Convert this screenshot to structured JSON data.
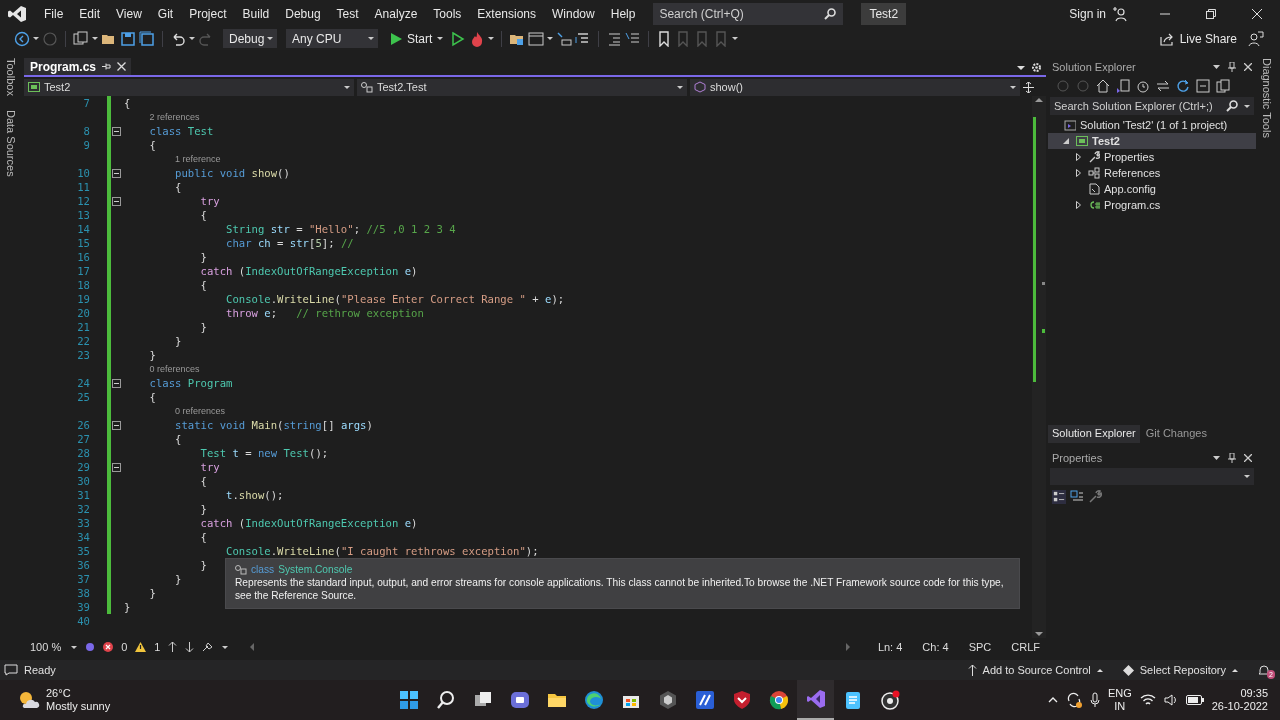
{
  "menu_bar": {
    "items": [
      "File",
      "Edit",
      "View",
      "Git",
      "Project",
      "Build",
      "Debug",
      "Test",
      "Analyze",
      "Tools",
      "Extensions",
      "Window",
      "Help"
    ],
    "search": {
      "placeholder": "Search (Ctrl+Q)"
    },
    "solution_name": "Test2",
    "sign_in": "Sign in"
  },
  "toolbar": {
    "configuration": "Debug",
    "platform": "Any CPU",
    "start": "Start",
    "live_share": "Live Share"
  },
  "left_strip": [
    "Toolbox",
    "Data Sources"
  ],
  "right_strip": [
    "Diagnostic Tools"
  ],
  "editor": {
    "tabs": [
      {
        "label": "Program.cs",
        "selected": true
      }
    ],
    "nav": [
      "Test2",
      "Test2.Test",
      "show()"
    ],
    "lines": [
      {
        "kind": "code",
        "num": "7",
        "changed": true,
        "tokens": [
          {
            "kind": "txt",
            "text": "{"
          }
        ]
      },
      {
        "kind": "lens",
        "changed": true,
        "text": "2 references"
      },
      {
        "kind": "code",
        "num": "8",
        "changed": true,
        "fold": true,
        "tokens": [
          {
            "kind": "kw",
            "text": "    class "
          },
          {
            "kind": "type",
            "text": "Test"
          }
        ]
      },
      {
        "kind": "code",
        "num": "9",
        "changed": true,
        "tokens": [
          {
            "kind": "txt",
            "text": "    {"
          }
        ]
      },
      {
        "kind": "lens",
        "changed": true,
        "text": "1 reference"
      },
      {
        "kind": "code",
        "num": "10",
        "changed": true,
        "fold": true,
        "tokens": [
          {
            "kind": "kw",
            "text": "        public void "
          },
          {
            "kind": "fn",
            "text": "show"
          },
          {
            "kind": "txt",
            "text": "()"
          }
        ]
      },
      {
        "kind": "code",
        "num": "11",
        "changed": true,
        "tokens": [
          {
            "kind": "txt",
            "text": "        {"
          }
        ]
      },
      {
        "kind": "code",
        "num": "12",
        "changed": true,
        "fold": true,
        "tokens": [
          {
            "kind": "ctl",
            "text": "            try"
          }
        ]
      },
      {
        "kind": "code",
        "num": "13",
        "changed": true,
        "tokens": [
          {
            "kind": "txt",
            "text": "            {"
          }
        ]
      },
      {
        "kind": "code",
        "num": "14",
        "changed": true,
        "tokens": [
          {
            "kind": "type",
            "text": "                String"
          },
          {
            "kind": "var",
            "text": " str"
          },
          {
            "kind": "txt",
            "text": " = "
          },
          {
            "kind": "str",
            "text": "\"Hello\""
          },
          {
            "kind": "txt",
            "text": "; "
          },
          {
            "kind": "cmt",
            "text": "//5 ,0 1 2 3 4"
          }
        ]
      },
      {
        "kind": "code",
        "num": "15",
        "changed": true,
        "tokens": [
          {
            "kind": "kw",
            "text": "                char"
          },
          {
            "kind": "var",
            "text": " ch"
          },
          {
            "kind": "txt",
            "text": " = "
          },
          {
            "kind": "var",
            "text": "str"
          },
          {
            "kind": "txt",
            "text": "["
          },
          {
            "kind": "num",
            "text": "5"
          },
          {
            "kind": "txt",
            "text": "]; "
          },
          {
            "kind": "cmt",
            "text": "//"
          }
        ]
      },
      {
        "kind": "code",
        "num": "16",
        "changed": true,
        "tokens": [
          {
            "kind": "txt",
            "text": "            }"
          }
        ]
      },
      {
        "kind": "code",
        "num": "17",
        "changed": true,
        "tokens": [
          {
            "kind": "ctl",
            "text": "            catch"
          },
          {
            "kind": "txt",
            "text": " ("
          },
          {
            "kind": "type",
            "text": "IndexOutOfRangeException"
          },
          {
            "kind": "var",
            "text": " e"
          },
          {
            "kind": "txt",
            "text": ")"
          }
        ]
      },
      {
        "kind": "code",
        "num": "18",
        "changed": true,
        "tokens": [
          {
            "kind": "txt",
            "text": "            {"
          }
        ]
      },
      {
        "kind": "code",
        "num": "19",
        "changed": true,
        "tokens": [
          {
            "kind": "type",
            "text": "                Console"
          },
          {
            "kind": "txt",
            "text": "."
          },
          {
            "kind": "fn",
            "text": "WriteLine"
          },
          {
            "kind": "txt",
            "text": "("
          },
          {
            "kind": "str",
            "text": "\"Please Enter Correct Range \""
          },
          {
            "kind": "txt",
            "text": " + "
          },
          {
            "kind": "var",
            "text": "e"
          },
          {
            "kind": "txt",
            "text": ");"
          }
        ]
      },
      {
        "kind": "code",
        "num": "20",
        "changed": true,
        "tokens": [
          {
            "kind": "ctl",
            "text": "                throw"
          },
          {
            "kind": "var",
            "text": " e"
          },
          {
            "kind": "txt",
            "text": ";   "
          },
          {
            "kind": "cmt",
            "text": "// rethrow exception"
          }
        ]
      },
      {
        "kind": "code",
        "num": "21",
        "changed": true,
        "tokens": [
          {
            "kind": "txt",
            "text": "            }"
          }
        ]
      },
      {
        "kind": "code",
        "num": "22",
        "changed": true,
        "tokens": [
          {
            "kind": "txt",
            "text": "        }"
          }
        ]
      },
      {
        "kind": "code",
        "num": "23",
        "changed": true,
        "tokens": [
          {
            "kind": "txt",
            "text": "    }"
          }
        ]
      },
      {
        "kind": "lens",
        "changed": true,
        "text": "0 references"
      },
      {
        "kind": "code",
        "num": "24",
        "changed": true,
        "fold": true,
        "tokens": [
          {
            "kind": "kw",
            "text": "    class "
          },
          {
            "kind": "type",
            "text": "Program"
          }
        ]
      },
      {
        "kind": "code",
        "num": "25",
        "changed": true,
        "tokens": [
          {
            "kind": "txt",
            "text": "    {"
          }
        ]
      },
      {
        "kind": "lens",
        "changed": true,
        "text": "0 references"
      },
      {
        "kind": "code",
        "num": "26",
        "changed": true,
        "fold": true,
        "tokens": [
          {
            "kind": "kw",
            "text": "        static void "
          },
          {
            "kind": "fn",
            "text": "Main"
          },
          {
            "kind": "txt",
            "text": "("
          },
          {
            "kind": "kw",
            "text": "string"
          },
          {
            "kind": "txt",
            "text": "[] "
          },
          {
            "kind": "var",
            "text": "args"
          },
          {
            "kind": "txt",
            "text": ")"
          }
        ]
      },
      {
        "kind": "code",
        "num": "27",
        "changed": true,
        "tokens": [
          {
            "kind": "txt",
            "text": "        {"
          }
        ]
      },
      {
        "kind": "code",
        "num": "28",
        "changed": true,
        "tokens": [
          {
            "kind": "type",
            "text": "            Test"
          },
          {
            "kind": "var",
            "text": " t"
          },
          {
            "kind": "txt",
            "text": " = "
          },
          {
            "kind": "kw",
            "text": "new"
          },
          {
            "kind": "type",
            "text": " Test"
          },
          {
            "kind": "txt",
            "text": "();"
          }
        ]
      },
      {
        "kind": "code",
        "num": "29",
        "changed": true,
        "fold": true,
        "tokens": [
          {
            "kind": "ctl",
            "text": "            try"
          }
        ]
      },
      {
        "kind": "code",
        "num": "30",
        "changed": true,
        "tokens": [
          {
            "kind": "txt",
            "text": "            {"
          }
        ]
      },
      {
        "kind": "code",
        "num": "31",
        "changed": true,
        "tokens": [
          {
            "kind": "var",
            "text": "                t"
          },
          {
            "kind": "txt",
            "text": "."
          },
          {
            "kind": "fn",
            "text": "show"
          },
          {
            "kind": "txt",
            "text": "();"
          }
        ]
      },
      {
        "kind": "code",
        "num": "32",
        "changed": true,
        "tokens": [
          {
            "kind": "txt",
            "text": "            }"
          }
        ]
      },
      {
        "kind": "code",
        "num": "33",
        "changed": true,
        "tokens": [
          {
            "kind": "ctl",
            "text": "            catch"
          },
          {
            "kind": "txt",
            "text": " ("
          },
          {
            "kind": "type",
            "text": "IndexOutOfRangeException"
          },
          {
            "kind": "var",
            "text": " e"
          },
          {
            "kind": "txt",
            "text": ")"
          }
        ]
      },
      {
        "kind": "code",
        "num": "34",
        "changed": true,
        "tokens": [
          {
            "kind": "txt",
            "text": "            {"
          }
        ]
      },
      {
        "kind": "code",
        "num": "35",
        "changed": true,
        "tokens": [
          {
            "kind": "type",
            "text": "                Console"
          },
          {
            "kind": "txt",
            "text": "."
          },
          {
            "kind": "fn",
            "text": "WriteLine"
          },
          {
            "kind": "txt",
            "text": "("
          },
          {
            "kind": "str",
            "text": "\"I caught rethrows exception\""
          },
          {
            "kind": "txt",
            "text": ");"
          }
        ]
      },
      {
        "kind": "code",
        "num": "36",
        "changed": true,
        "tokens": [
          {
            "kind": "txt",
            "text": "            }"
          }
        ]
      },
      {
        "kind": "code",
        "num": "37",
        "changed": true,
        "tokens": [
          {
            "kind": "txt",
            "text": "        }"
          }
        ]
      },
      {
        "kind": "code",
        "num": "38",
        "changed": true,
        "tokens": [
          {
            "kind": "txt",
            "text": "    }"
          }
        ]
      },
      {
        "kind": "code",
        "num": "39",
        "changed": true,
        "tokens": [
          {
            "kind": "txt",
            "text": "}"
          }
        ]
      },
      {
        "kind": "code",
        "num": "40",
        "changed": false
      }
    ],
    "tooltip": {
      "keyword": "class",
      "name": "System.Console",
      "description": "Represents the standard input, output, and error streams for console applications. This class cannot be inherited.To browse the .NET Framework source code for this type, see the Reference Source."
    },
    "status": {
      "zoom": "100 %",
      "errors": "0",
      "warnings": "1",
      "line": "Ln: 4",
      "column": "Ch: 4",
      "whitespace": "SPC",
      "line_ending": "CRLF"
    }
  },
  "solution_explorer": {
    "title": "Solution Explorer",
    "search": {
      "placeholder": "Search Solution Explorer (Ctrl+;)"
    },
    "tree": [
      {
        "kind": "solution",
        "label": "Solution 'Test2' (1 of 1 project)",
        "selected": false,
        "children": [
          {
            "kind": "project",
            "label": "Test2",
            "selected": true,
            "expanded": true,
            "children": [
              {
                "kind": "properties",
                "label": "Properties",
                "selected": false,
                "expanded": false
              },
              {
                "kind": "references",
                "label": "References",
                "selected": false,
                "expanded": false
              },
              {
                "kind": "config",
                "label": "App.config",
                "selected": false
              },
              {
                "kind": "csfile",
                "label": "Program.cs",
                "selected": false,
                "expanded": false
              }
            ]
          }
        ]
      }
    ],
    "tabs": [
      {
        "label": "Solution Explorer",
        "selected": true
      },
      {
        "label": "Git Changes",
        "selected": false
      }
    ]
  },
  "properties": {
    "title": "Properties"
  },
  "status_bar": {
    "message": "Ready",
    "source_control": "Add to Source Control",
    "repository": "Select Repository",
    "notifications": "2"
  },
  "taskbar": {
    "temperature": "26°C",
    "weather": "Mostly sunny",
    "language": "ENG",
    "region": "IN",
    "time": "09:35",
    "date": "26-10-2022"
  }
}
